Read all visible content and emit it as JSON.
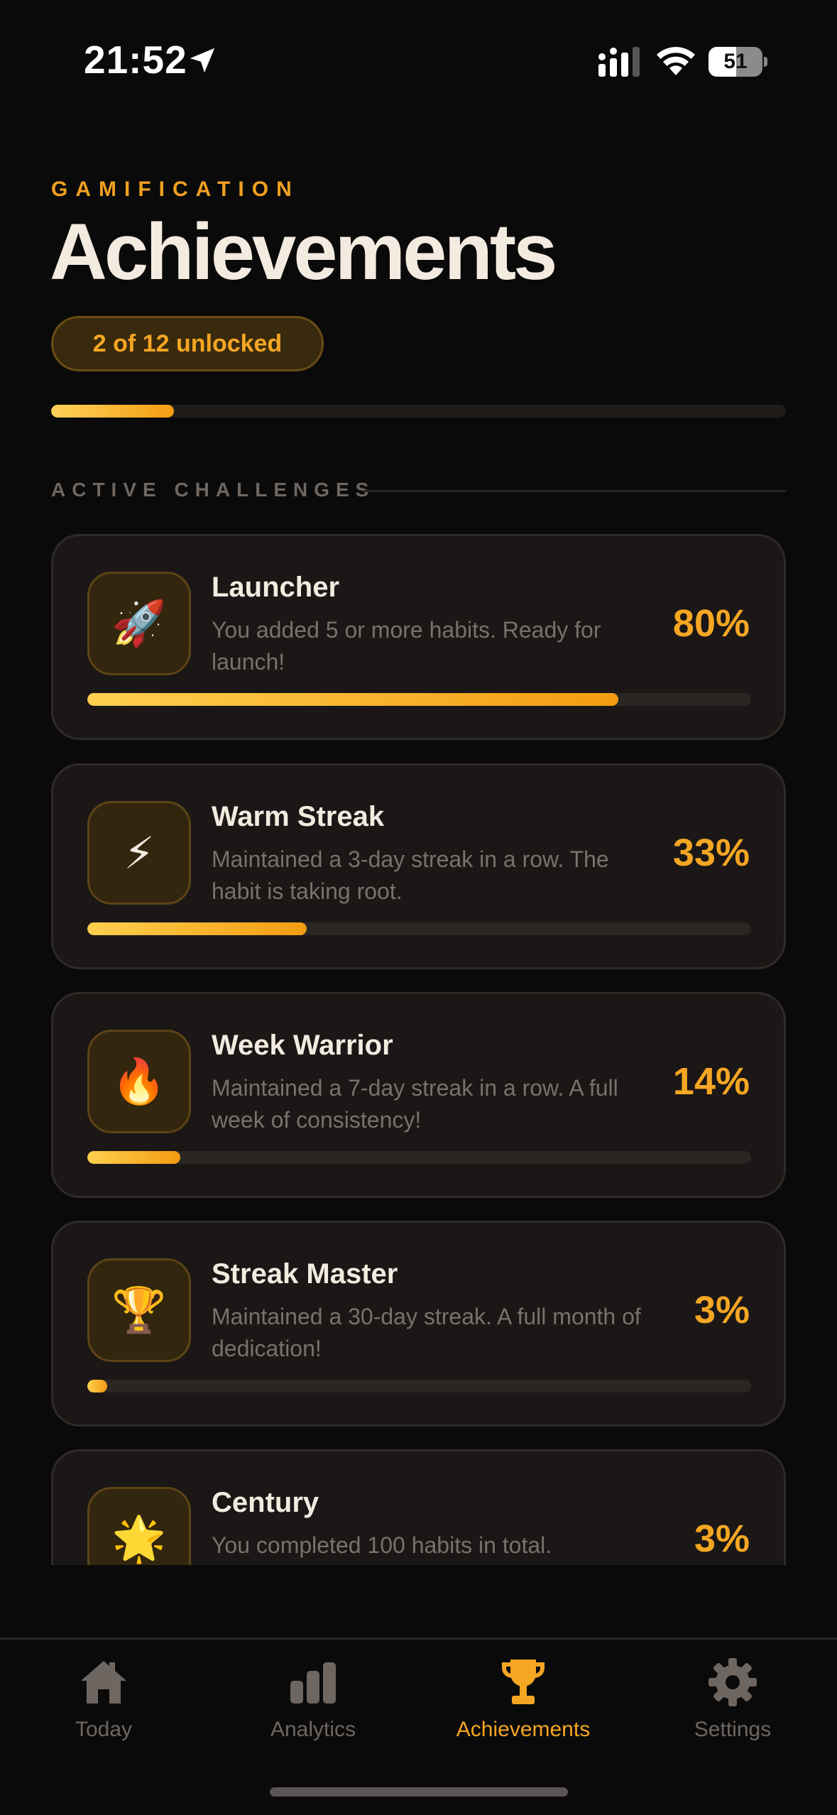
{
  "status_bar": {
    "time": "21:52",
    "battery": "51",
    "battery_level": 0.51,
    "icons": [
      "location-arrow-icon",
      "cellular-signal-icon",
      "wifi-icon",
      "battery-icon"
    ]
  },
  "header": {
    "eyebrow": "GAMIFICATION",
    "title": "Achievements",
    "unlocked_label": "2 of 12 unlocked",
    "overall_progress": 0.1667
  },
  "section": {
    "label": "ACTIVE CHALLENGES"
  },
  "challenges": [
    {
      "icon": "🚀",
      "icon_name": "rocket-icon",
      "title": "Launcher",
      "description": "You added 5 or more habits. Ready for launch!",
      "percent_label": "80%",
      "progress": 0.8
    },
    {
      "icon": "⚡",
      "icon_name": "lightning-icon",
      "title": "Warm Streak",
      "description": "Maintained a 3-day streak in a row. The habit is taking root.",
      "percent_label": "33%",
      "progress": 0.33
    },
    {
      "icon": "🔥",
      "icon_name": "fire-icon",
      "title": "Week Warrior",
      "description": "Maintained a 7-day streak in a row. A full week of consistency!",
      "percent_label": "14%",
      "progress": 0.14
    },
    {
      "icon": "🏆",
      "icon_name": "trophy-icon",
      "title": "Streak Master",
      "description": "Maintained a 30-day streak. A full month of dedication!",
      "percent_label": "3%",
      "progress": 0.03
    },
    {
      "icon": "🌟",
      "icon_name": "star-icon",
      "title": "Century",
      "description": "You completed 100 habits in total.",
      "percent_label": "3%",
      "progress": 0.03
    }
  ],
  "tabs": [
    {
      "label": "Today",
      "icon": "home-icon",
      "active": false
    },
    {
      "label": "Analytics",
      "icon": "bar-chart-icon",
      "active": false
    },
    {
      "label": "Achievements",
      "icon": "trophy-icon",
      "active": true
    },
    {
      "label": "Settings",
      "icon": "gear-icon",
      "active": false
    }
  ],
  "colors": {
    "accent": "#f5a623",
    "background": "#0b0a0a",
    "card": "#1b1716",
    "muted_text": "#7a716a",
    "inactive_tab": "#6e6660"
  }
}
